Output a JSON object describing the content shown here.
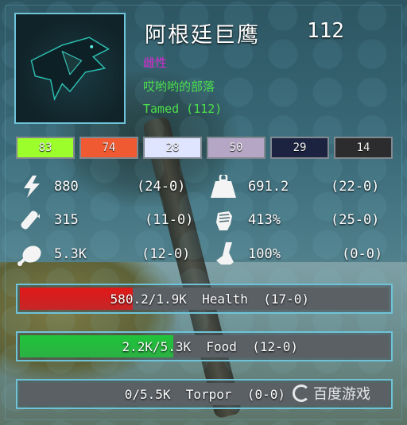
{
  "creature": {
    "name": "阿根廷巨鹰",
    "level": "112",
    "gender": "雌性",
    "tribe": "哎哟哟的部落",
    "tamed": "Tamed  (112)"
  },
  "color_regions": [
    {
      "value": "83",
      "color": "#9cff2c"
    },
    {
      "value": "74",
      "color": "#f05a32"
    },
    {
      "value": "28",
      "color": "#dfe4ff"
    },
    {
      "value": "50",
      "color": "#b6a6c6"
    },
    {
      "value": "29",
      "color": "#1c2340"
    },
    {
      "value": "14",
      "color": "#2c2c2e"
    }
  ],
  "stats": {
    "stamina": {
      "icon": "lightning-icon",
      "value": "880",
      "points": "(24-0)"
    },
    "weight": {
      "icon": "weight-icon",
      "value": "691.2",
      "points": "(22-0)"
    },
    "oxygen": {
      "icon": "oxygen-tank-icon",
      "value": "315",
      "points": "(11-0)"
    },
    "melee": {
      "icon": "fist-icon",
      "value": "413%",
      "points": "(25-0)"
    },
    "food_stat": {
      "icon": "meat-icon",
      "value": "5.3K",
      "points": "(12-0)"
    },
    "speed": {
      "icon": "boot-icon",
      "value": "100%",
      "points": "(0-0)"
    }
  },
  "bars": {
    "health": {
      "text": "580.2/1.9K  Health  (17-0)",
      "fill": 0.305,
      "color": "#e01818"
    },
    "food": {
      "text": "2.2K/5.3K  Food  (12-0)",
      "fill": 0.415,
      "color": "#1fc43a"
    },
    "torpor": {
      "text": "0/5.5K  Torpor  (0-0)",
      "fill": 0,
      "color": "#8a3fc4"
    }
  },
  "watermark": "百度游戏"
}
